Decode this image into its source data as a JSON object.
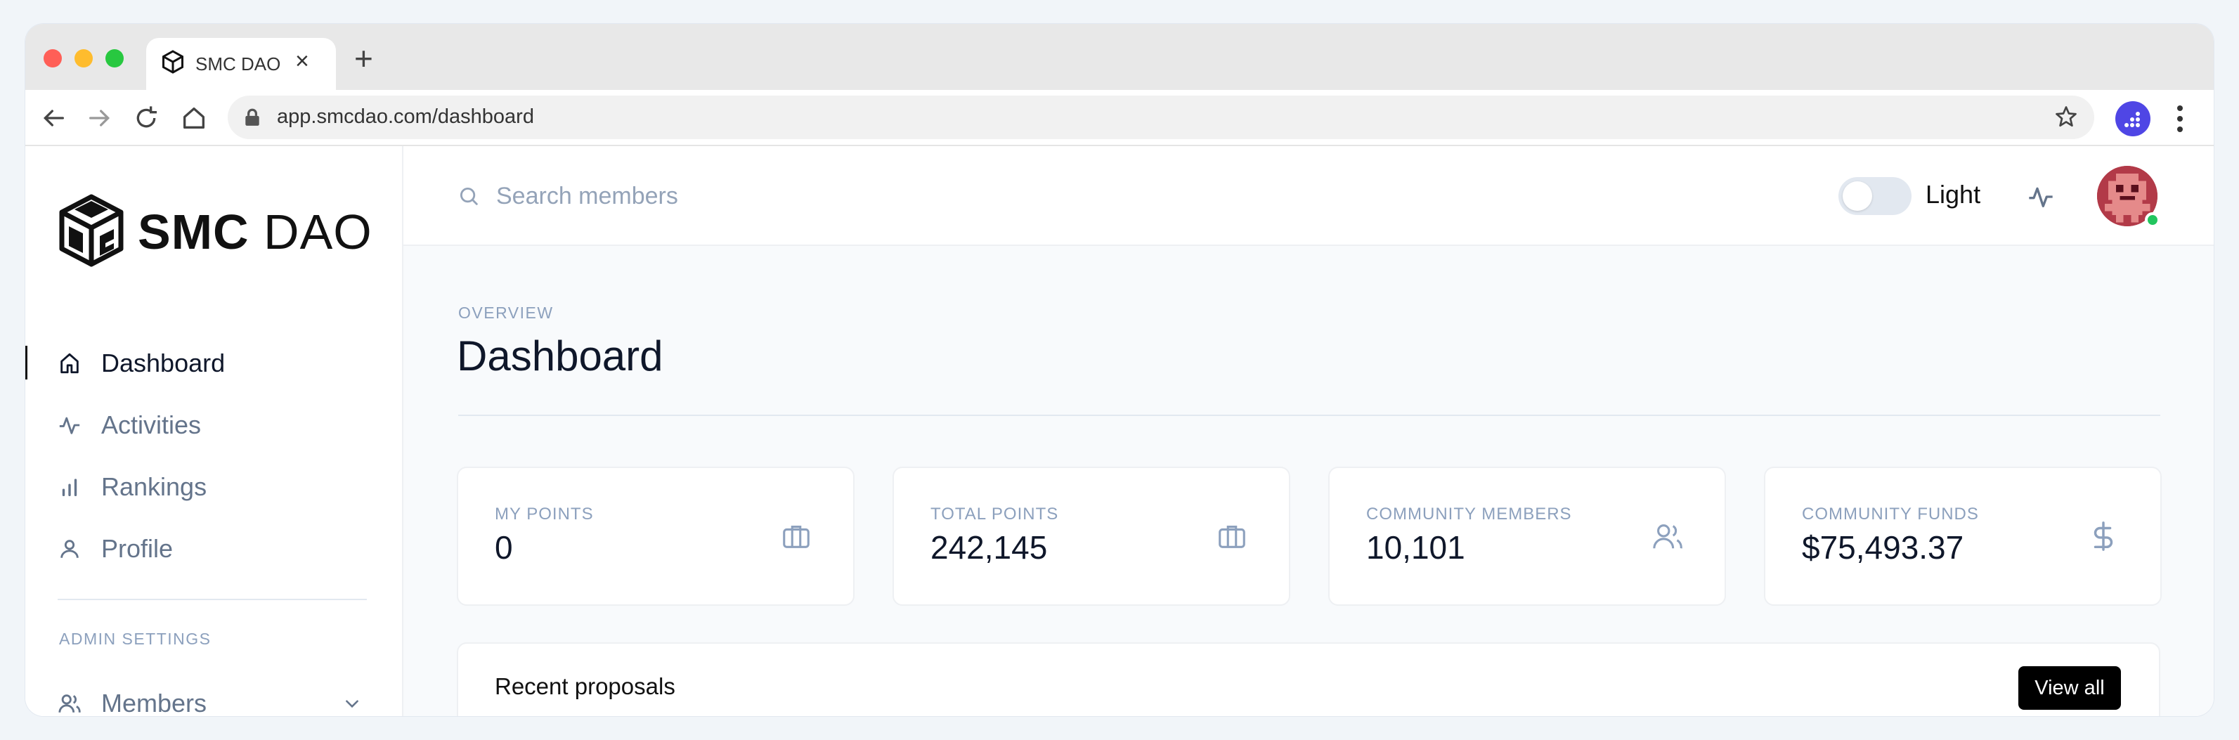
{
  "browser": {
    "tab_title": "SMC DAO",
    "tab_close": "×",
    "new_tab": "+",
    "url": "app.smcdao.com/dashboard"
  },
  "sidebar": {
    "logo_bold": "SMC",
    "logo_light": "DAO",
    "items": [
      {
        "label": "Dashboard",
        "icon": "home-icon",
        "active": true
      },
      {
        "label": "Activities",
        "icon": "activity-icon"
      },
      {
        "label": "Rankings",
        "icon": "bar-chart-icon"
      },
      {
        "label": "Profile",
        "icon": "user-icon"
      }
    ],
    "admin_label": "ADMIN SETTINGS",
    "admin_items": [
      {
        "label": "Members",
        "icon": "users-icon"
      }
    ]
  },
  "header": {
    "search_placeholder": "Search members",
    "theme_label": "Light"
  },
  "page": {
    "eyebrow": "OVERVIEW",
    "title": "Dashboard"
  },
  "stats": [
    {
      "label": "MY POINTS",
      "value": "0",
      "icon": "briefcase-icon"
    },
    {
      "label": "TOTAL POINTS",
      "value": "242,145",
      "icon": "briefcase-icon"
    },
    {
      "label": "COMMUNITY MEMBERS",
      "value": "10,101",
      "icon": "users-icon"
    },
    {
      "label": "COMMUNITY FUNDS",
      "value": "$75,493.37",
      "icon": "dollar-icon"
    }
  ],
  "proposals": {
    "title": "Recent proposals",
    "view_all": "View all"
  },
  "colors": {
    "accent": "#000000",
    "muted": "#8ca0bd",
    "online": "#22c55e",
    "extension": "#4f46e5"
  }
}
